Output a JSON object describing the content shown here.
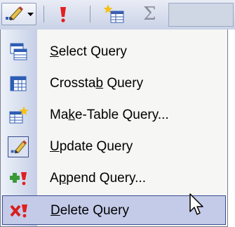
{
  "toolbar": {
    "buttons": [
      {
        "name": "query-type-dropdown",
        "icon": "update-query-pencil-icon"
      },
      {
        "name": "run",
        "icon": "exclamation-icon"
      },
      {
        "name": "show-table",
        "icon": "show-table-icon"
      },
      {
        "name": "totals",
        "icon": "sigma-icon",
        "glyph": "Σ"
      }
    ]
  },
  "menu": {
    "items": [
      {
        "key": "select",
        "pre": "",
        "mnemonic": "S",
        "post": "elect Query",
        "icon": "select-query-icon",
        "highlighted": false,
        "checked": false
      },
      {
        "key": "crosstab",
        "pre": "Crossta",
        "mnemonic": "b",
        "post": " Query",
        "icon": "crosstab-query-icon",
        "highlighted": false,
        "checked": false
      },
      {
        "key": "make-table",
        "pre": "Ma",
        "mnemonic": "k",
        "post": "e-Table Query...",
        "icon": "make-table-query-icon",
        "highlighted": false,
        "checked": false
      },
      {
        "key": "update",
        "pre": "",
        "mnemonic": "U",
        "post": "pdate Query",
        "icon": "update-query-icon",
        "highlighted": false,
        "checked": true
      },
      {
        "key": "append",
        "pre": "A",
        "mnemonic": "p",
        "post": "pend Query...",
        "icon": "append-query-icon",
        "highlighted": false,
        "checked": false
      },
      {
        "key": "delete",
        "pre": "",
        "mnemonic": "D",
        "post": "elete Query",
        "icon": "delete-query-icon",
        "highlighted": true,
        "checked": false
      }
    ]
  },
  "colors": {
    "highlight_bg": "#c4cbe8",
    "highlight_border": "#3a4c8f",
    "exclamation": "#e02020"
  }
}
